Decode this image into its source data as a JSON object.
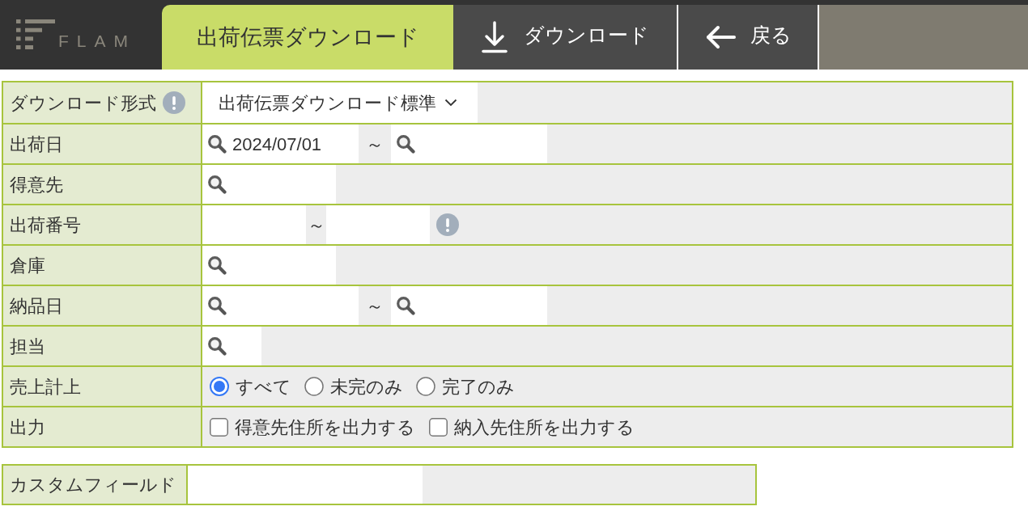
{
  "header": {
    "logo": "FLAM",
    "tab": {
      "label": "出荷伝票ダウンロード",
      "selected": true
    },
    "buttons": [
      {
        "kind": "download",
        "label": "ダウンロード"
      },
      {
        "kind": "back",
        "label": "戻る"
      }
    ]
  },
  "form": {
    "rows": [
      {
        "kind": "select",
        "label": "ダウンロード形式",
        "info": true,
        "value": "出荷伝票ダウンロード標準"
      },
      {
        "kind": "inputs",
        "label": "出荷日",
        "fields": [
          {
            "kind": "date",
            "search": true,
            "value": "2024/07/01"
          },
          {
            "kind": "date",
            "search": true
          }
        ],
        "separator": "～"
      },
      {
        "kind": "inputs",
        "label": "得意先",
        "fields": [
          {
            "kind": "lookup",
            "search": true
          }
        ]
      },
      {
        "kind": "inputs",
        "label": "出荷番号",
        "fields": [
          {
            "kind": "code",
            "search": false
          },
          {
            "kind": "code",
            "search": false
          }
        ],
        "separator": "～",
        "info": true
      },
      {
        "kind": "inputs",
        "label": "倉庫",
        "fields": [
          {
            "kind": "lookup",
            "search": true
          }
        ]
      },
      {
        "kind": "inputs",
        "label": "納品日",
        "fields": [
          {
            "kind": "date",
            "search": true
          },
          {
            "kind": "date",
            "search": true
          }
        ],
        "separator": "～"
      },
      {
        "kind": "inputs",
        "label": "担当",
        "fields": [
          {
            "kind": "staff",
            "search": true
          }
        ]
      },
      {
        "kind": "radio",
        "label": "売上計上",
        "options": [
          {
            "label": "すべて",
            "selected": true
          },
          {
            "label": "未完のみ",
            "selected": false
          },
          {
            "label": "完了のみ",
            "selected": false
          }
        ]
      },
      {
        "kind": "checkbox",
        "label": "出力",
        "options": [
          {
            "label": "得意先住所を出力する",
            "checked": false
          },
          {
            "label": "納入先住所を出力する",
            "checked": false
          }
        ]
      }
    ]
  },
  "custom_fields": {
    "label": "カスタムフィールド",
    "fields": [
      {
        "kind": "text",
        "search": false
      }
    ]
  }
}
